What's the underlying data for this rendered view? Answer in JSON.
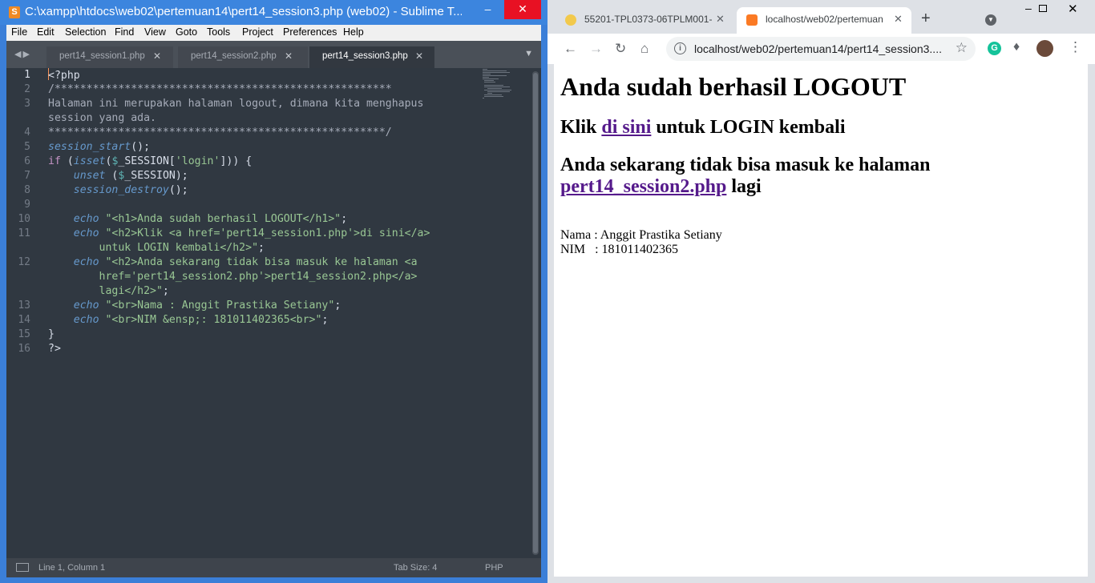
{
  "sublime": {
    "title": "C:\\xampp\\htdocs\\web02\\pertemuan14\\pert14_session3.php (web02) - Sublime T...",
    "app_icon": "S",
    "menu": [
      "File",
      "Edit",
      "Selection",
      "Find",
      "View",
      "Goto",
      "Tools",
      "Project",
      "Preferences",
      "Help"
    ],
    "tabs": [
      {
        "label": "pert14_session1.php",
        "active": false
      },
      {
        "label": "pert14_session2.php",
        "active": false
      },
      {
        "label": "pert14_session3.php",
        "active": true
      }
    ],
    "code_lines": [
      [
        [
          "pl",
          "<?php"
        ]
      ],
      [
        [
          "cm",
          "/*****************************************************"
        ]
      ],
      [
        [
          "cm",
          "Halaman ini merupakan halaman logout, dimana kita menghapus"
        ]
      ],
      [
        [
          "cm",
          "session yang ada."
        ]
      ],
      [
        [
          "cm",
          "*****************************************************/"
        ]
      ],
      [
        [
          "fn",
          "session_start"
        ],
        [
          "pl",
          "();"
        ]
      ],
      [
        [
          "kw",
          "if"
        ],
        [
          "pl",
          " ("
        ],
        [
          "fn",
          "isset"
        ],
        [
          "pl",
          "("
        ],
        [
          "vr",
          "$"
        ],
        [
          "pl",
          "_SESSION["
        ],
        [
          "st",
          "'login'"
        ],
        [
          "pl",
          "])) {"
        ]
      ],
      [
        [
          "pl",
          "    "
        ],
        [
          "fn",
          "unset"
        ],
        [
          "pl",
          " ("
        ],
        [
          "vr",
          "$"
        ],
        [
          "pl",
          "_SESSION);"
        ]
      ],
      [
        [
          "pl",
          "    "
        ],
        [
          "fn",
          "session_destroy"
        ],
        [
          "pl",
          "();"
        ]
      ],
      [
        [
          "pl",
          ""
        ]
      ],
      [
        [
          "pl",
          "    "
        ],
        [
          "fn",
          "echo"
        ],
        [
          "pl",
          " "
        ],
        [
          "st",
          "\"<h1>Anda sudah berhasil LOGOUT</h1>\""
        ],
        [
          "pl",
          ";"
        ]
      ],
      [
        [
          "pl",
          "    "
        ],
        [
          "fn",
          "echo"
        ],
        [
          "pl",
          " "
        ],
        [
          "st",
          "\"<h2>Klik <a href='pert14_session1.php'>di sini</a>"
        ]
      ],
      [
        [
          "st",
          "        untuk LOGIN kembali</h2>\""
        ],
        [
          "pl",
          ";"
        ]
      ],
      [
        [
          "pl",
          "    "
        ],
        [
          "fn",
          "echo"
        ],
        [
          "pl",
          " "
        ],
        [
          "st",
          "\"<h2>Anda sekarang tidak bisa masuk ke halaman <a"
        ]
      ],
      [
        [
          "st",
          "        href='pert14_session2.php'>pert14_session2.php</a>"
        ]
      ],
      [
        [
          "st",
          "        lagi</h2>\""
        ],
        [
          "pl",
          ";"
        ]
      ],
      [
        [
          "pl",
          "    "
        ],
        [
          "fn",
          "echo"
        ],
        [
          "pl",
          " "
        ],
        [
          "st",
          "\"<br>Nama : Anggit Prastika Setiany\""
        ],
        [
          "pl",
          ";"
        ]
      ],
      [
        [
          "pl",
          "    "
        ],
        [
          "fn",
          "echo"
        ],
        [
          "pl",
          " "
        ],
        [
          "st",
          "\"<br>NIM &ensp;: 181011402365<br>\""
        ],
        [
          "pl",
          ";"
        ]
      ],
      [
        [
          "pl",
          "}"
        ]
      ],
      [
        [
          "pl",
          "?>"
        ]
      ]
    ],
    "line_numbers": [
      "1",
      "2",
      "3",
      "",
      "4",
      "5",
      "6",
      "7",
      "8",
      "9",
      "10",
      "11",
      "",
      "12",
      "",
      "",
      "13",
      "14",
      "15",
      "16"
    ],
    "status": {
      "position": "Line 1, Column 1",
      "tab_size": "Tab Size: 4",
      "syntax": "PHP"
    }
  },
  "chrome": {
    "tabs": [
      {
        "label": "55201-TPL0373-06TPLM001-",
        "active": false
      },
      {
        "label": "localhost/web02/pertemuan",
        "active": true
      }
    ],
    "new_tab": "+",
    "url": "localhost/web02/pertemuan14/pert14_session3....",
    "page": {
      "h1": "Anda sudah berhasil LOGOUT",
      "h2a_pre": "Klik ",
      "h2a_link": "di sini",
      "h2a_post": " untuk LOGIN kembali",
      "h2b_pre": "Anda sekarang tidak bisa masuk ke halaman",
      "h2b_link": "pert14_session2.php",
      "h2b_post": " lagi",
      "nama": "Nama : Anggit Prastika Setiany",
      "nim": "NIM   : 181011402365"
    }
  }
}
